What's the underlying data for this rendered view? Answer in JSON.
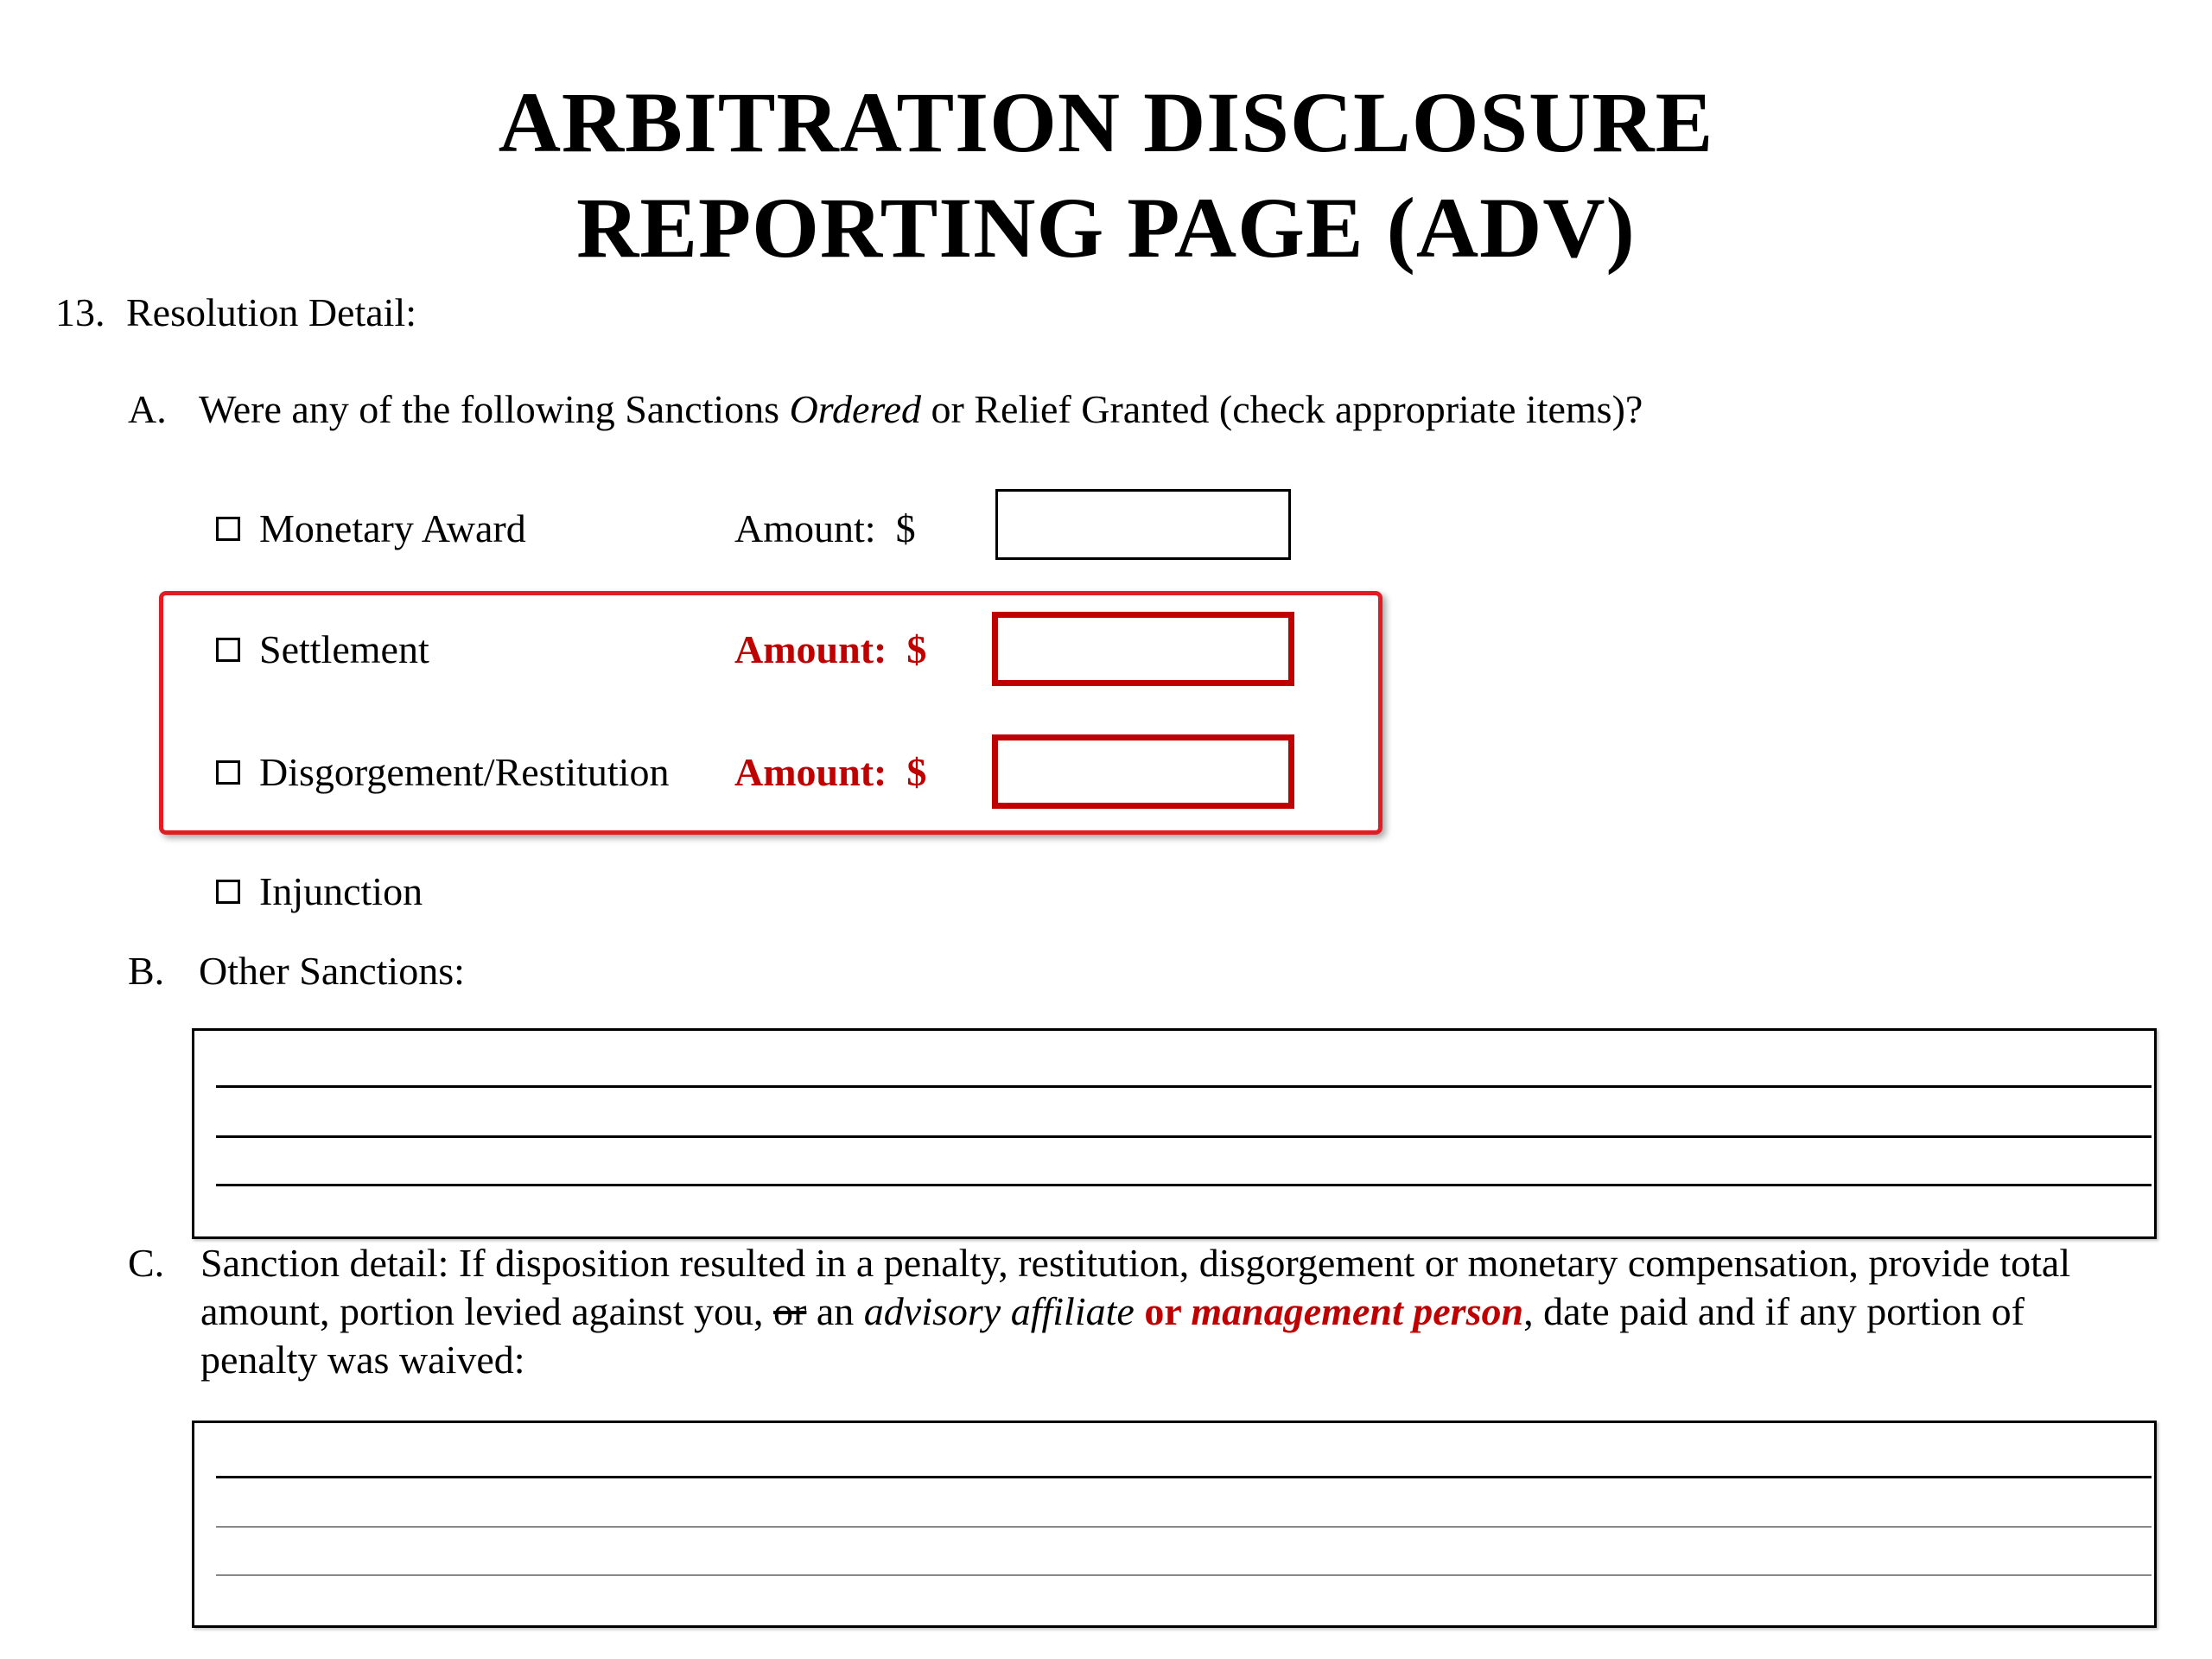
{
  "title": {
    "line1": "ARBITRATION DISCLOSURE",
    "line2": "REPORTING PAGE  (ADV)"
  },
  "section13": {
    "number": "13.",
    "label": "Resolution Detail:"
  },
  "partA": {
    "letter": "A.",
    "text_before": "Were any of the following Sanctions ",
    "text_italic": "Ordered",
    "text_after": " or Relief Granted (check appropriate items)?",
    "items": [
      {
        "label": "Monetary Award",
        "amount_word": "Amount:",
        "amount_symbol": "$",
        "amount_value": ""
      },
      {
        "label": "Settlement",
        "amount_word": "Amount:",
        "amount_symbol": "$",
        "amount_value": ""
      },
      {
        "label": "Disgorgement/Restitution",
        "amount_word": "Amount:",
        "amount_symbol": "$",
        "amount_value": ""
      },
      {
        "label": "Injunction"
      }
    ]
  },
  "partB": {
    "letter": "B.",
    "label": "Other Sanctions:",
    "value": ""
  },
  "partC": {
    "letter": "C.",
    "line1": "Sanction detail:  If disposition resulted in a penalty, restitution, disgorgement or monetary compensation, provide total",
    "line2_a": "amount, portion levied against you, ",
    "line2_strike": "or",
    "line2_b": " an ",
    "line2_italic": "advisory affiliate",
    "line2_red_bold": " or ",
    "line2_red_bold_italic": "management person",
    "line2_c": ", date paid and if any portion of",
    "line3": "penalty was waived:",
    "value": ""
  },
  "colors": {
    "highlight_frame": "#e31b23",
    "highlight_text": "#c00000"
  }
}
